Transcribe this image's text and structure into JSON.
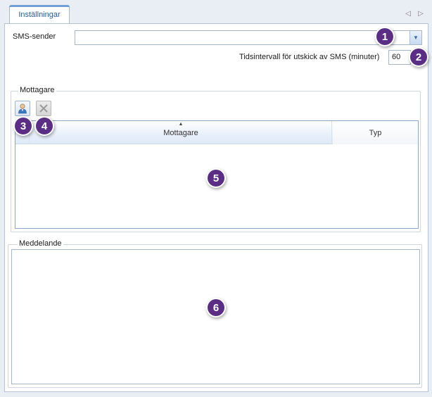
{
  "tab": {
    "label": "Inställningar"
  },
  "nav": {
    "prev": "◁",
    "next": "▷"
  },
  "sms_sender": {
    "label": "SMS-sender",
    "value": ""
  },
  "interval": {
    "label": "Tidsintervall för utskick av SMS (minuter)",
    "value": "60"
  },
  "recipients": {
    "group_title": "Mottagare",
    "columns": [
      {
        "label": "Mottagare",
        "sorted": "ascending"
      },
      {
        "label": "Typ"
      }
    ],
    "rows": []
  },
  "message": {
    "group_title": "Meddelande",
    "value": ""
  },
  "callouts": [
    "1",
    "2",
    "3",
    "4",
    "5",
    "6"
  ],
  "colors": {
    "callout": "#5b2e85",
    "accent": "#2b5a94"
  }
}
